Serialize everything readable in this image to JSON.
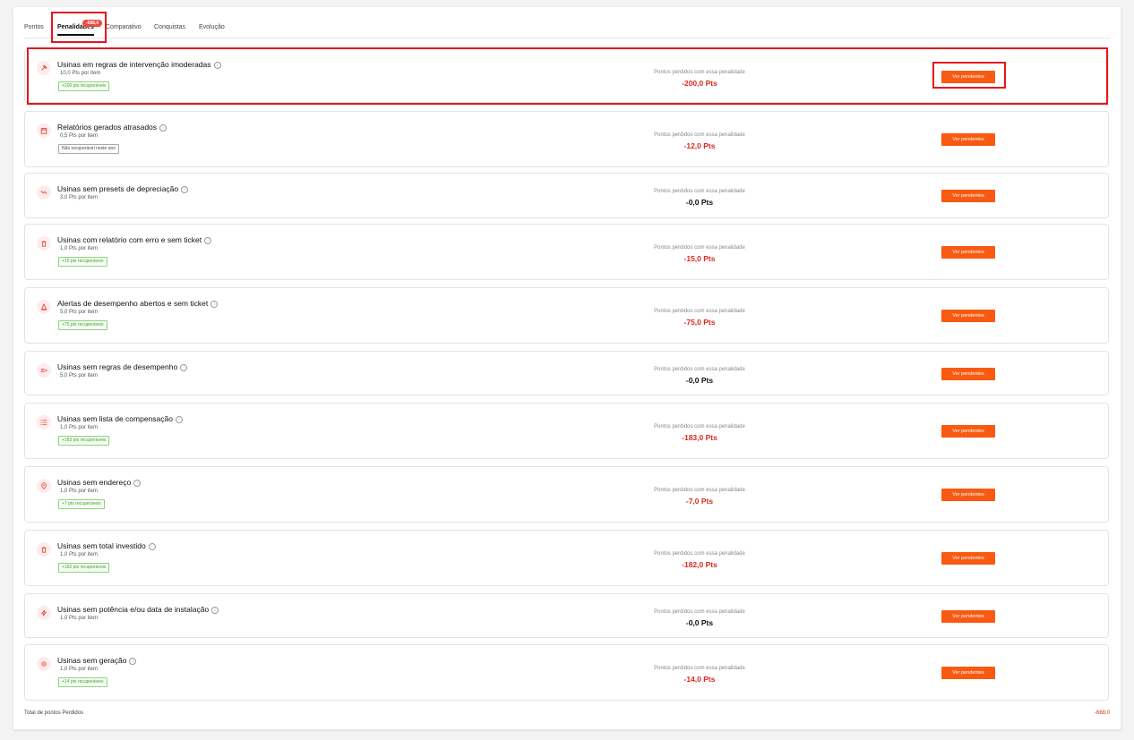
{
  "tabs": [
    {
      "label": "Pontos"
    },
    {
      "label": "Penalidades",
      "active": true,
      "badge": "-688,0"
    },
    {
      "label": "Comparativo"
    },
    {
      "label": "Conquistas"
    },
    {
      "label": "Evolução"
    }
  ],
  "lost_label": "Pontos perdidos com essa penalidade",
  "button_label": "Ver pendentes",
  "penalties": [
    {
      "icon": "gavel-icon",
      "title": "Usinas em regras de intervenção imoderadas",
      "per_item": "10,0 Pts por item",
      "tag": "+200 pts recuperáveis",
      "tag_type": "green",
      "lost": "-200,0 Pts",
      "lost_color": "red"
    },
    {
      "icon": "calendar-icon",
      "title": "Relatórios gerados atrasados",
      "per_item": "0,5 Pts por item",
      "tag": "Não recuperável neste ano",
      "tag_type": "gray",
      "lost": "-12,0 Pts",
      "lost_color": "red"
    },
    {
      "icon": "trend-down-icon",
      "title": "Usinas sem presets de depreciação",
      "per_item": "3,0 Pts por item",
      "tag": "",
      "tag_type": "",
      "lost": "-0,0 Pts",
      "lost_color": "dark"
    },
    {
      "icon": "trash-icon",
      "title": "Usinas com relatório com erro e sem ticket",
      "per_item": "1,0 Pts por item",
      "tag": "+15 pts recuperáveis",
      "tag_type": "green",
      "lost": "-15,0 Pts",
      "lost_color": "red"
    },
    {
      "icon": "alarm-icon",
      "title": "Alertas de desempenho abertos e sem ticket",
      "per_item": "5,0 Pts por item",
      "tag": "+75 pts recuperáveis",
      "tag_type": "green",
      "lost": "-75,0 Pts",
      "lost_color": "red"
    },
    {
      "icon": "list-x-icon",
      "title": "Usinas sem regras de desempenho",
      "per_item": "5,0 Pts por item",
      "tag": "",
      "tag_type": "",
      "lost": "-0,0 Pts",
      "lost_color": "dark"
    },
    {
      "icon": "list-icon",
      "title": "Usinas sem lista de compensação",
      "per_item": "1,0 Pts por item",
      "tag": "+183 pts recuperáveis",
      "tag_type": "green",
      "lost": "-183,0 Pts",
      "lost_color": "red"
    },
    {
      "icon": "map-pin-icon",
      "title": "Usinas sem endereço",
      "per_item": "1,0 Pts por item",
      "tag": "+7 pts recuperáveis",
      "tag_type": "green",
      "lost": "-7,0 Pts",
      "lost_color": "red"
    },
    {
      "icon": "trash-icon",
      "title": "Usinas sem total investido",
      "per_item": "1,0 Pts por item",
      "tag": "+182 pts recuperáveis",
      "tag_type": "green",
      "lost": "-182,0 Pts",
      "lost_color": "red"
    },
    {
      "icon": "lightning-icon",
      "title": "Usinas sem potência e/ou data de instalação",
      "per_item": "1,0 Pts por item",
      "tag": "",
      "tag_type": "",
      "lost": "-0,0 Pts",
      "lost_color": "dark"
    },
    {
      "icon": "gear-icon",
      "title": "Usinas sem geração",
      "per_item": "1,0 Pts por item",
      "tag": "+14 pts recuperáveis",
      "tag_type": "green",
      "lost": "-14,0 Pts",
      "lost_color": "red"
    }
  ],
  "footer": {
    "label": "Total de pontos Perdidos",
    "value": "-688,0"
  }
}
